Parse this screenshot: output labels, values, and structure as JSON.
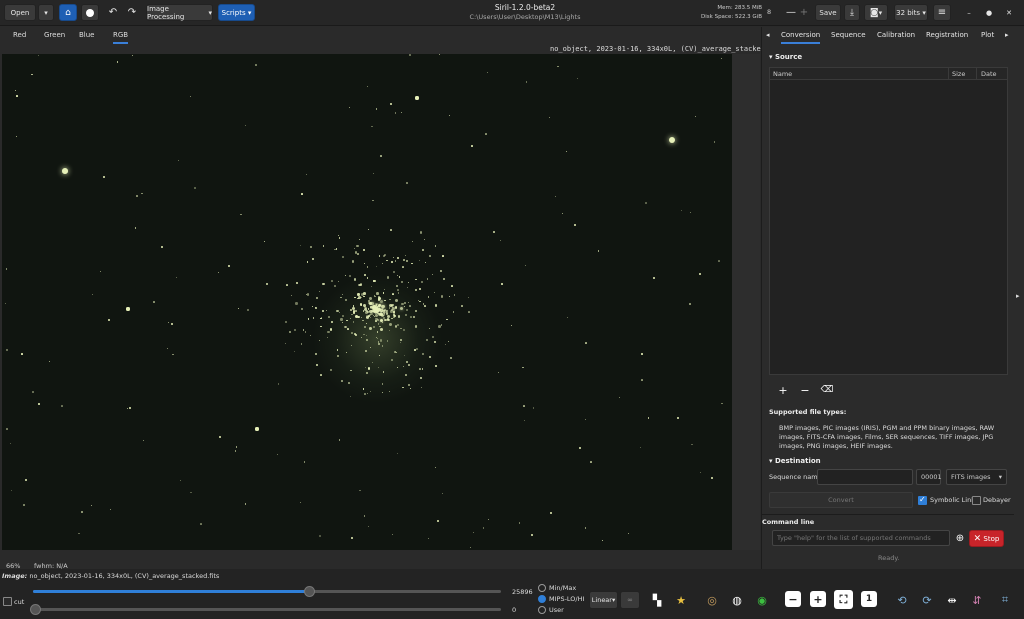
{
  "header": {
    "open_label": "Open",
    "image_processing_label": "Image Processing",
    "scripts_label": "Scripts",
    "app_title": "Siril-1.2.0-beta2",
    "path": "C:\\Users\\User\\Desktop\\M13\\Lights",
    "mem": "Mem: 283.5 MiB",
    "disk": "Disk Space: 522.3 GiB",
    "zoom_value": "8",
    "save_label": "Save",
    "bits_label": "32 bits"
  },
  "channels": {
    "red": "Red",
    "green": "Green",
    "blue": "Blue",
    "rgb": "RGB"
  },
  "viewer": {
    "image_label": "no_object, 2023-01-16, 334x0L, (CV)_average_stacked.fits",
    "zoom": "66%",
    "fwhm": "fwhm:  N/A"
  },
  "right_panel": {
    "tabs": [
      "Conversion",
      "Sequence",
      "Calibration",
      "Registration",
      "Plot"
    ],
    "source_title": "Source",
    "col_name": "Name",
    "col_size": "Size",
    "col_date": "Date",
    "supported_title": "Supported file types:",
    "supported_text": "BMP images, PIC images (IRIS), PGM and PPM binary images, RAW images, FITS-CFA images, Films, SER sequences, TIFF images, JPG images, PNG images, HEIF images.",
    "destination_title": "Destination",
    "seq_name_label": "Sequence name:",
    "seq_name_value": "",
    "start_index": "00001",
    "output_type": "FITS images",
    "convert_label": "Convert",
    "symbolic_link_label": "Symbolic Link",
    "debayer_label": "Debayer",
    "command_line_title": "Command line",
    "command_placeholder": "Type \"help\" for the list of supported commands",
    "stop_label": "Stop",
    "ready": "Ready."
  },
  "bottom": {
    "image_info_prefix": "Image:",
    "image_info": "no_object, 2023-01-16, 334x0L, (CV)_average_stacked.fits",
    "hi_value": "25896",
    "lo_value": "0",
    "cut_label": "cut",
    "minmax_label": "Min/Max",
    "mips_label": "MIPS-LO/HI",
    "user_label": "User",
    "stretch_label": "Linear",
    "hi_level": 0.59,
    "lo_level": 0.0
  },
  "colors": {
    "accent_blue": "#1e5fb4",
    "stop_red": "#c8242a",
    "star_color": "#e6f0b8"
  }
}
